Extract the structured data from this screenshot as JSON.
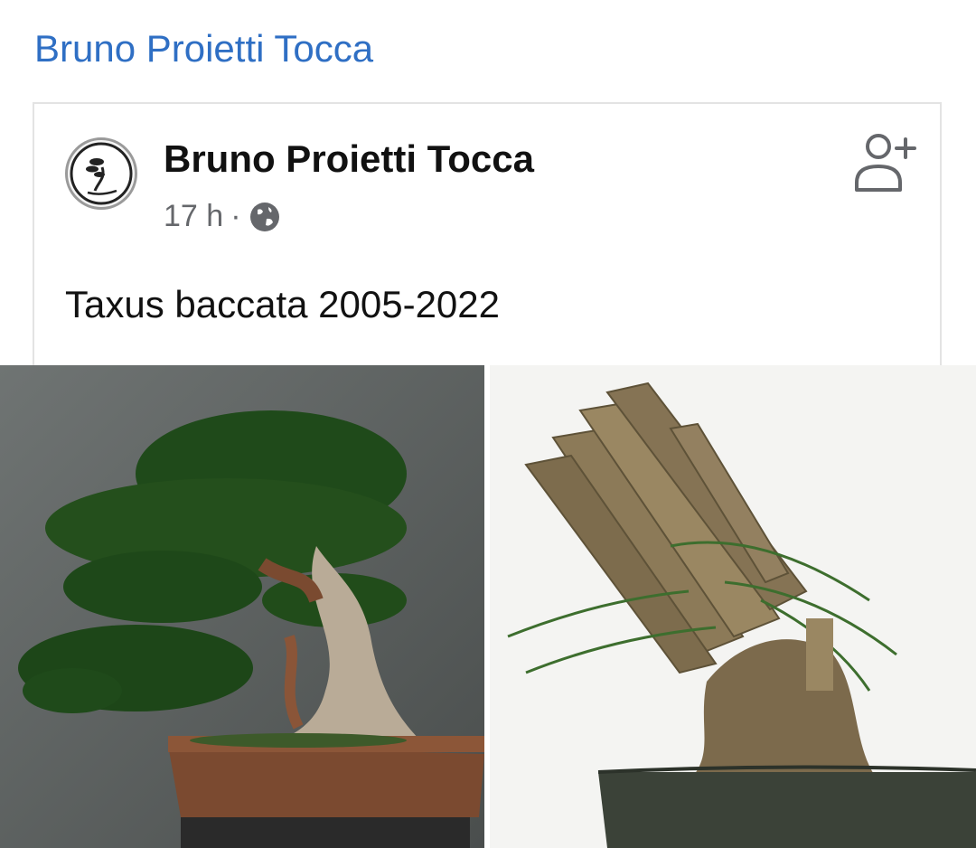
{
  "page": {
    "title": "Bruno Proietti Tocca"
  },
  "post": {
    "author": "Bruno Proietti Tocca",
    "time": "17 h",
    "separator": "·",
    "audience_icon": "globe-icon",
    "text": "Taxus baccata 2005-2022",
    "action_icon": "add-friend-icon"
  },
  "photos": [
    {
      "subject": "yew bonsai in brown rectangular pot (after)"
    },
    {
      "subject": "yew stump with cut branches in black pot (before)"
    }
  ],
  "colors": {
    "link": "#2f6fc4",
    "meta": "#65676b",
    "border": "#e3e3e3"
  }
}
